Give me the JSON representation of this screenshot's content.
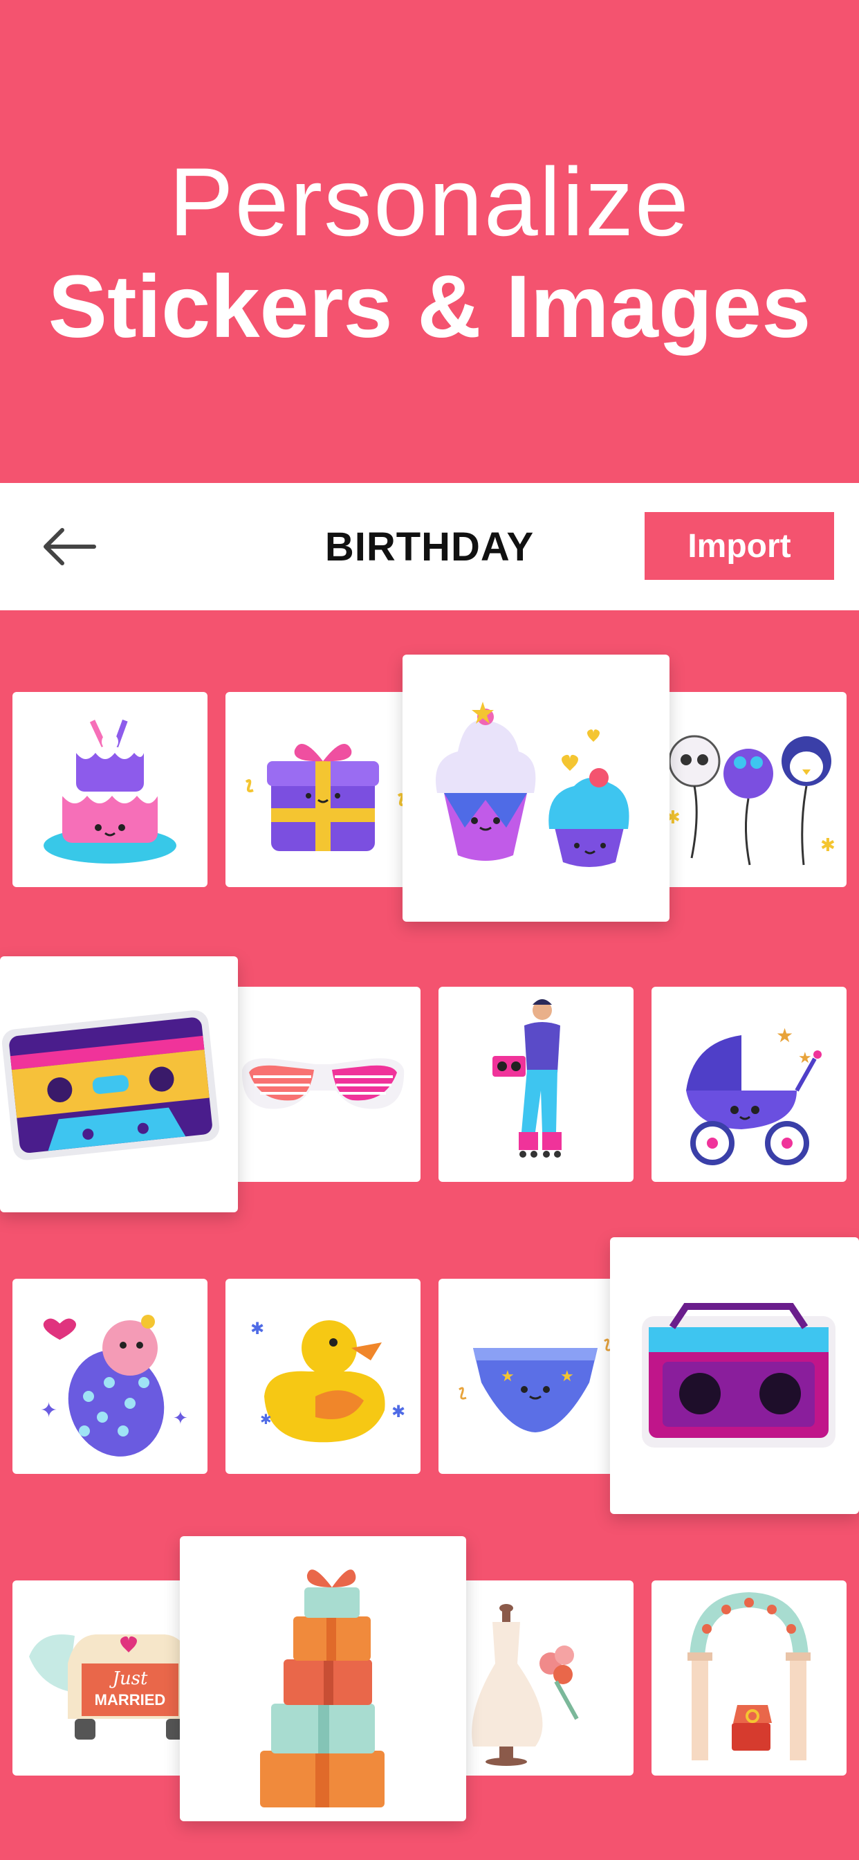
{
  "hero": {
    "line1": "Personalize",
    "line2": "Stickers & Images"
  },
  "topbar": {
    "title": "BIRTHDAY",
    "import_label": "Import",
    "back_icon": "arrow-left-icon"
  },
  "stickers": [
    {
      "name": "cake",
      "icon": "cake-sticker"
    },
    {
      "name": "gift box",
      "icon": "gift-sticker"
    },
    {
      "name": "cupcakes",
      "icon": "cupcake-sticker"
    },
    {
      "name": "animal balloons",
      "icon": "balloons-sticker"
    },
    {
      "name": "cassette tape",
      "icon": "cassette-sticker"
    },
    {
      "name": "shutter shades",
      "icon": "glasses-sticker"
    },
    {
      "name": "roller skater",
      "icon": "skater-sticker"
    },
    {
      "name": "baby stroller",
      "icon": "stroller-sticker"
    },
    {
      "name": "swaddled baby",
      "icon": "baby-sticker"
    },
    {
      "name": "rubber duck",
      "icon": "duck-sticker"
    },
    {
      "name": "diaper",
      "icon": "diaper-sticker"
    },
    {
      "name": "boombox",
      "icon": "boombox-sticker"
    },
    {
      "name": "just married car",
      "icon": "car-sticker",
      "text1": "Just",
      "text2": "MARRIED"
    },
    {
      "name": "stacked presents",
      "icon": "presents-sticker"
    },
    {
      "name": "wedding dress",
      "icon": "dress-sticker"
    },
    {
      "name": "wedding arch",
      "icon": "arch-sticker"
    }
  ],
  "colors": {
    "brand": "#F4536F",
    "card": "#FFFFFF"
  }
}
